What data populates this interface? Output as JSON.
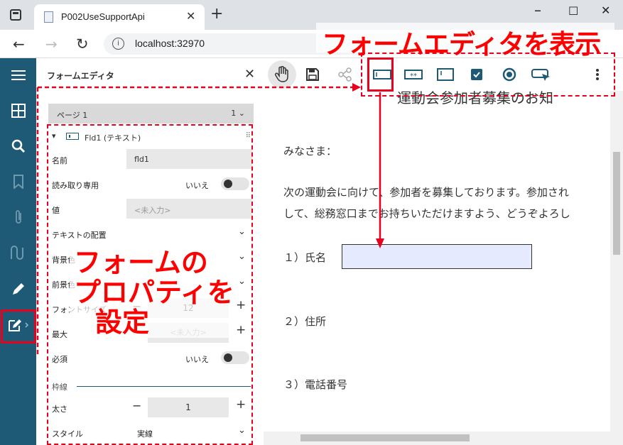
{
  "browser": {
    "tab_title": "P002UseSupportApi",
    "url": "localhost:32970"
  },
  "panel": {
    "title": "フォームエディタ",
    "page_label": "ページ 1",
    "page_value": "1",
    "field_header": "Fld1 (テキスト)",
    "rows": {
      "name_label": "名前",
      "name_value": "fld1",
      "readonly_label": "読み取り専用",
      "readonly_value": "いいえ",
      "value_label": "値",
      "value_placeholder": "<未入力>",
      "alignment_label": "テキストの配置",
      "bg_label": "背景色",
      "fg_label": "前景色",
      "fontsize_label": "フォントサイズ",
      "fontsize_value": "12",
      "maxlen_label": "最大",
      "maxlen_placeholder": "<未入力>",
      "required_label": "必須",
      "required_value": "いいえ",
      "border_section": "枠線",
      "thickness_label": "太さ",
      "thickness_value": "1",
      "style_label": "スタイル",
      "style_value": "実線"
    }
  },
  "annotations": {
    "top": "フォームエディタを表示",
    "left_line1": "フォームの",
    "left_line2": "プロパティを",
    "left_line3": "設定"
  },
  "document": {
    "title": "運動会参加者募集のお知",
    "greeting": "みなさま：",
    "body_line1": "次の運動会に向けて、参加者を募集しております。参加され",
    "body_line2": "して、総務窓口までお持ちいただけますよう、どうぞよろし",
    "item1": "１）氏名",
    "item2": "２）住所",
    "item3": "３）電話番号"
  },
  "colors": {
    "sidebar": "#1e5a75",
    "annotation": "#ff0000",
    "field_fill": "#e6eaff"
  }
}
